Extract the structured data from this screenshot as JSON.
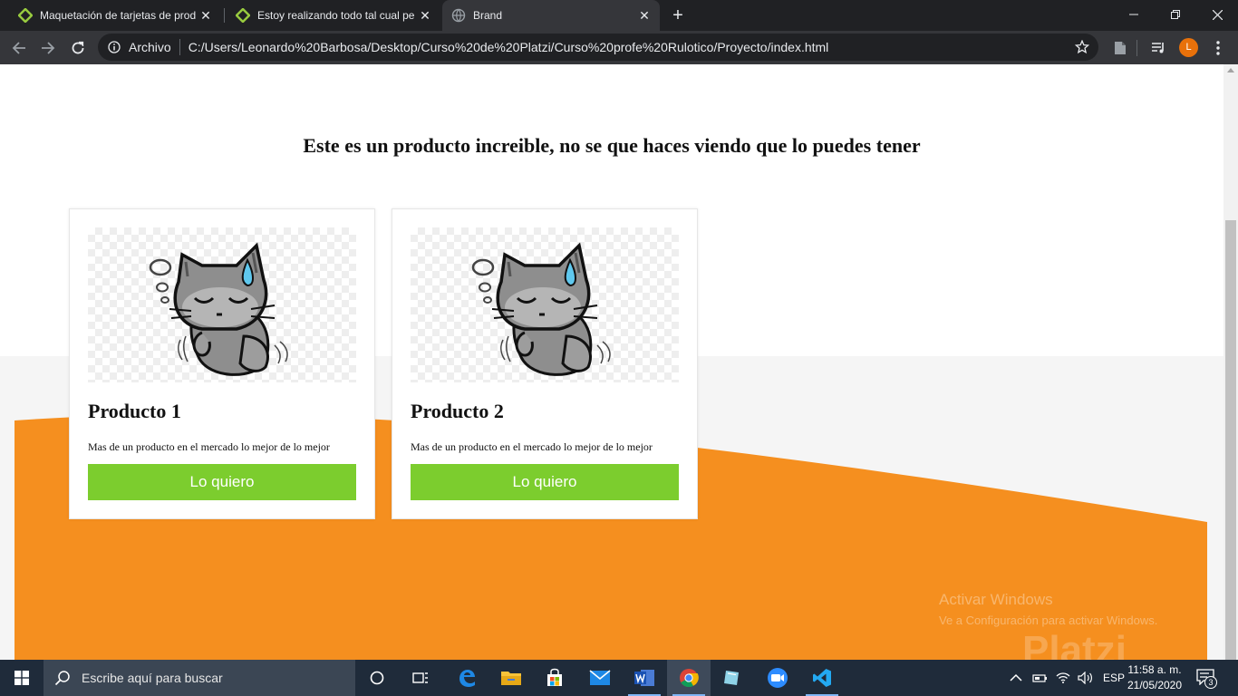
{
  "browser": {
    "tabs": [
      {
        "title": "Maquetación de tarjetas de prod",
        "favicon": "platzi-icon",
        "active": false
      },
      {
        "title": "Estoy realizando todo tal cual pe",
        "favicon": "platzi-icon",
        "active": false
      },
      {
        "title": "Brand",
        "favicon": "globe-icon",
        "active": true
      }
    ],
    "omnibox": {
      "label": "Archivo",
      "url": "C:/Users/Leonardo%20Barbosa/Desktop/Curso%20de%20Platzi/Curso%20profe%20Rulotico/Proyecto/index.html"
    },
    "profile_initial": "L"
  },
  "page": {
    "heading": "Este es un producto increible, no se que haces viendo que lo puedes tener",
    "cards": [
      {
        "title": "Producto 1",
        "text": "Mas de un producto en el mercado lo mejor de lo mejor",
        "button": "Lo quiero"
      },
      {
        "title": "Producto 2",
        "text": "Mas de un producto en el mercado lo mejor de lo mejor",
        "button": "Lo quiero"
      }
    ],
    "colors": {
      "accent_green": "#7ccd2e",
      "wave_orange": "#f58f1f",
      "band_grey": "#f5f5f5"
    }
  },
  "watermark": {
    "line1": "Activar Windows",
    "line2": "Ve a Configuración para activar Windows.",
    "platzi": "Platzi"
  },
  "taskbar": {
    "search_placeholder": "Escribe aquí para buscar",
    "language": "ESP",
    "time": "11:58 a. m.",
    "date": "21/05/2020",
    "notification_count": "3"
  }
}
